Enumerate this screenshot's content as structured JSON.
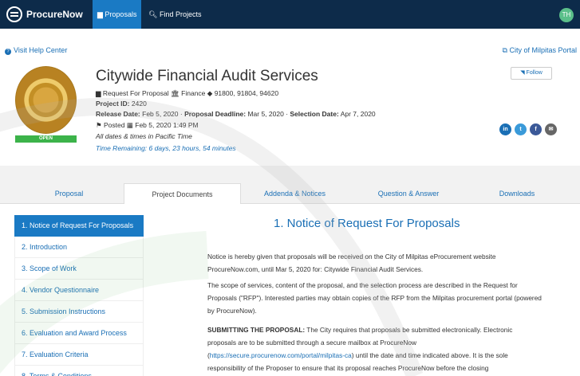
{
  "nav": {
    "brand": "ProcureNow",
    "proposals_label": "Proposals",
    "find_label": "Find Projects",
    "avatar_initials": "TH"
  },
  "helpbar": {
    "help_label": "Visit Help Center",
    "city_label": "City of Milpitas Portal"
  },
  "project": {
    "title": "Citywide Financial Audit Services",
    "type": "Request For Proposal",
    "department": "Finance",
    "codes": "91800, 91804, 94620",
    "project_id_label": "Project ID:",
    "project_id": "2420",
    "release_label": "Release Date:",
    "release_date": "Feb 5, 2020",
    "deadline_label": "Proposal Deadline:",
    "deadline": "Mar 5, 2020",
    "selection_label": "Selection Date:",
    "selection_date": "Apr 7, 2020",
    "posted_label": "Posted",
    "posted_date": "Feb 5, 2020 1:49 PM",
    "timezone_note": "All dates & times in Pacific Time",
    "time_remaining": "Time Remaining: 6 days, 23 hours, 54 minutes",
    "status_badge": "OPEN",
    "follow_label": "Follow"
  },
  "social": [
    "in",
    "t",
    "f",
    "✉"
  ],
  "tabs": [
    {
      "label": "Proposal"
    },
    {
      "label": "Project Documents"
    },
    {
      "label": "Addenda & Notices"
    },
    {
      "label": "Question & Answer"
    },
    {
      "label": "Downloads"
    }
  ],
  "sidebar": {
    "items": [
      "1. Notice of Request For Proposals",
      "2. Introduction",
      "3. Scope of Work",
      "4. Vendor Questionnaire",
      "5. Submission Instructions",
      "6. Evaluation and Award Process",
      "7. Evaluation Criteria",
      "8. Terms & Conditions"
    ]
  },
  "content": {
    "heading": "1. Notice of Request For Proposals",
    "p1": "Notice is hereby given that proposals will be received on the City of Milpitas eProcurement website ProcureNow.com, until Mar 5, 2020 for: Citywide Financial Audit Services.",
    "p2": "The scope of services, content of the proposal, and the selection process are described in the Request for Proposals (\"RFP\"). Interested parties may obtain copies of the RFP from the Milpitas procurement portal (powered by ProcureNow).",
    "p3_bold": "SUBMITTING THE PROPOSAL:",
    "p3_a": " The City requires that proposals be submitted electronically. Electronic proposals are to be submitted through a secure mailbox at ProcureNow (",
    "p3_link": "https://secure.procurenow.com/portal/milpitas-ca",
    "p3_b": ") until the date and time indicated above. It is the sole responsibility of the Proposer to ensure that its proposal reaches ProcureNow before the closing"
  },
  "colors": {
    "nav_bg": "#0d2b4a",
    "accent": "#1a7ac4",
    "link": "#1a6fb5",
    "open_badge": "#3cb34a"
  }
}
